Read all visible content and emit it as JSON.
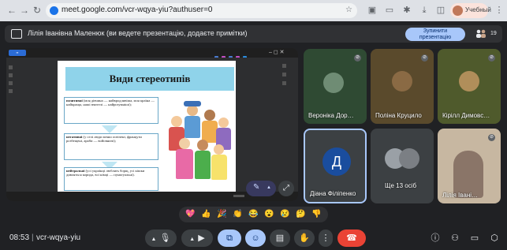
{
  "browser": {
    "url": "meet.google.com/vcr-wqya-yiu?authuser=0",
    "profile_label": "Учебный"
  },
  "banner": {
    "text": "Лілія Іванівна Маленюк (ви ведете презентацію, додаєте примітки)",
    "stop_button": "Зупинити презентацію",
    "participant_count": "19"
  },
  "presentation": {
    "slide_title": "Види стереотипів",
    "boxes": [
      {
        "term": "позитивні",
        "text": " (моя дівчина — найвродливіша, моя країна — найкраща, наші вчителі — найрозумніші);"
      },
      {
        "term": "негативні",
        "text": " (у селі люди менш освічені, французи розбещені, араби — войовничі);"
      },
      {
        "term": "нейтральні",
        "text": " (усі українці люблять борщ, усі кішки дивляться корида, всі німці — пунктуальні)."
      }
    ]
  },
  "participants": [
    {
      "name": "Вероніка Дор…"
    },
    {
      "name": "Поліна Круцило"
    },
    {
      "name": "Кірілл Димовс…"
    },
    {
      "name": "Діана Філіпенко",
      "initial": "Д"
    },
    {
      "name": "Ще 13 осіб"
    },
    {
      "name": "Лілія Івані…"
    }
  ],
  "reactions": [
    "💖",
    "👍",
    "🎉",
    "👏",
    "😂",
    "😮",
    "😢",
    "🤔",
    "👎"
  ],
  "bottom": {
    "time": "08:53",
    "meeting_code": "vcr-wqya-yiu"
  },
  "colors": {
    "accent": "#a8c7fa",
    "end_call": "#ea4335",
    "slide_header": "#8fd3ea"
  }
}
